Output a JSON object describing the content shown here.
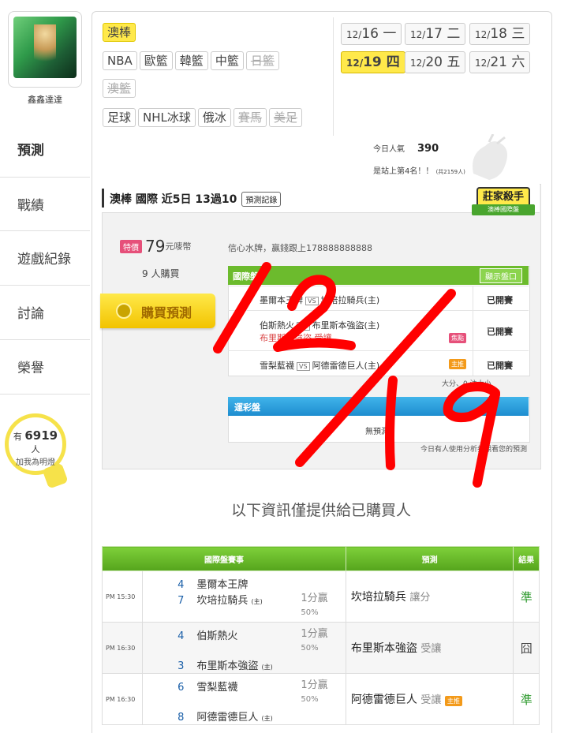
{
  "user": {
    "name": "鑫鑫達達"
  },
  "menu": [
    {
      "label": "預測"
    },
    {
      "label": "戰績"
    },
    {
      "label": "遊戲紀錄"
    },
    {
      "label": "討論"
    },
    {
      "label": "榮譽"
    }
  ],
  "fans": {
    "prefix": "有",
    "count": "6919",
    "suffix": "人",
    "line2": "加我為明燈"
  },
  "leagues": {
    "row1": [
      "澳棒"
    ],
    "row2": [
      "NBA",
      "歐籃",
      "韓籃",
      "中籃",
      "日籃"
    ],
    "row3": [
      "澳籃"
    ],
    "row4": [
      "足球",
      "NHL冰球",
      "俄冰",
      "賽馬",
      "美足"
    ]
  },
  "dates": [
    {
      "md": "12/",
      "d": "16",
      "w": "一"
    },
    {
      "md": "12/",
      "d": "17",
      "w": "二"
    },
    {
      "md": "12/",
      "d": "18",
      "w": "三"
    },
    {
      "md": "12/",
      "d": "19",
      "w": "四"
    },
    {
      "md": "12/",
      "d": "20",
      "w": "五"
    },
    {
      "md": "12/",
      "d": "21",
      "w": "六"
    }
  ],
  "popularity": {
    "label": "今日人氣",
    "value": "390",
    "rank": "是站上第4名！！",
    "rank_sub": "(共2159人)"
  },
  "pred": {
    "title": "澳棒 國際 近5日 13過10",
    "record_btn": "預測記錄",
    "badge_top": "莊家殺手",
    "badge_bottom": "澳棒國際盤",
    "price_tag": "特價",
    "price": "79",
    "price_unit": "元嘜幣",
    "buyers": "9 人購買",
    "buy_button": "購買預測",
    "confidence": "信心水牌，贏錢跟上178888888888",
    "intl_header": "國際盤",
    "show_btn": "顯示盤口",
    "rows": [
      {
        "a": "墨爾本王牌",
        "b": "坎培拉騎兵(主)",
        "status": "已開賽",
        "chip": ""
      },
      {
        "a": "伯斯熱火",
        "b": "布里斯本強盜(主)",
        "extra": "布里斯本強盜 受讓",
        "status": "已開賽",
        "chip": "焦點"
      },
      {
        "a": "雪梨藍襪",
        "b": "阿德雷德巨人(主)",
        "status": "已開賽",
        "chip": "主推"
      }
    ],
    "filter": "大分、0 注大小",
    "lottery_header": "運彩盤",
    "no_pred": "無預測",
    "today_note": "今日有人使用分析券觀看您的預測"
  },
  "info_note": "以下資訊僅提供給已購買人",
  "results": {
    "headers": [
      "國際盤賽事",
      "預測",
      "結果"
    ],
    "rows": [
      {
        "time": "PM 15:30",
        "n1": "4",
        "t1": "墨爾本王牌",
        "n2": "7",
        "t2": "坎培拉騎兵",
        "h": "(主)",
        "odds": "1分贏",
        "pct": "50%",
        "pick": "坎培拉騎兵",
        "lean": "讓分",
        "chip": "",
        "result": "準"
      },
      {
        "time": "PM 16:30",
        "n1": "4",
        "t1": "伯斯熱火",
        "n2": "3",
        "t2": "布里斯本強盜",
        "h": "(主)",
        "odds": "1分贏",
        "pct": "50%",
        "pick": "布里斯本強盜",
        "lean": "受讓",
        "chip": "",
        "result": "囧"
      },
      {
        "time": "PM 16:30",
        "n1": "6",
        "t1": "雪梨藍襪",
        "n2": "8",
        "t2": "阿德雷德巨人",
        "h": "(主)",
        "odds": "1分贏",
        "pct": "50%",
        "pick": "阿德雷德巨人",
        "lean": "受讓",
        "chip": "主推",
        "result": "準"
      }
    ]
  },
  "colors": {
    "accent_yellow": "#ffe94a",
    "green": "#6cbb2d",
    "blue": "#1e8dcf",
    "annotation_red": "#ff0000"
  }
}
